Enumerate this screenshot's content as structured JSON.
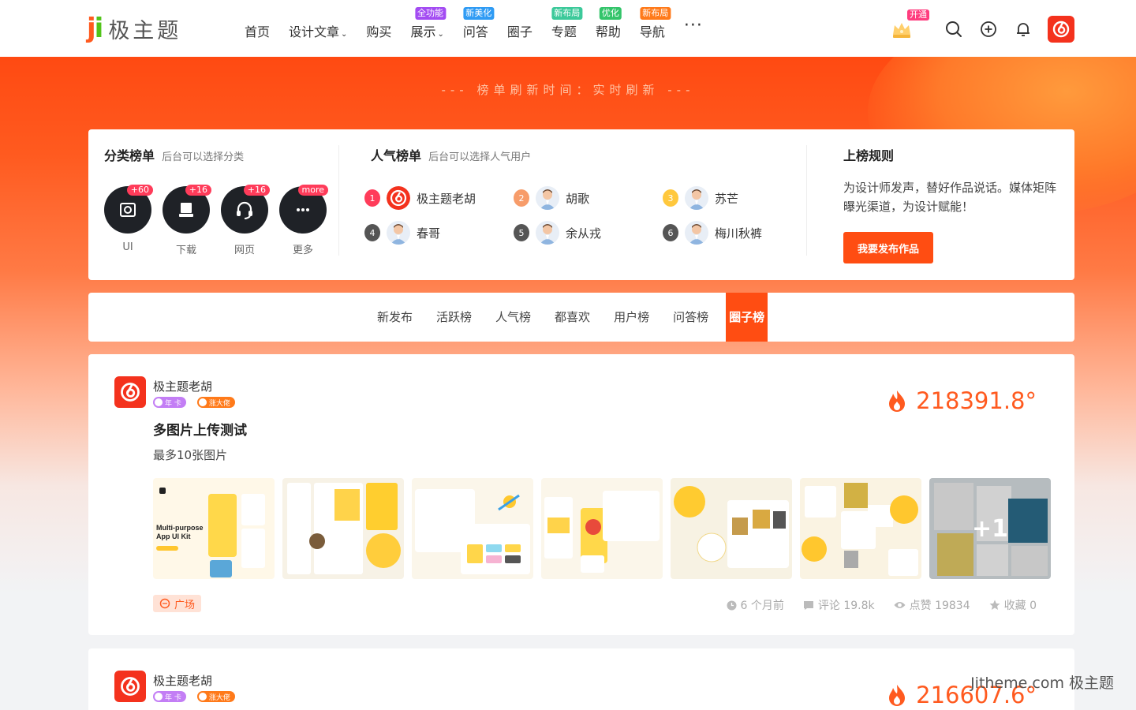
{
  "header": {
    "logo": {
      "mark": "ji",
      "text": "极主题"
    },
    "nav": [
      {
        "label": "首页",
        "badge": null,
        "dropdown": false
      },
      {
        "label": "设计文章",
        "badge": null,
        "dropdown": true
      },
      {
        "label": "购买",
        "badge": null,
        "dropdown": false
      },
      {
        "label": "展示",
        "badge": "全功能",
        "badge_color": "#a34cf2",
        "dropdown": true
      },
      {
        "label": "问答",
        "badge": "新美化",
        "badge_color": "#2f9bf4",
        "dropdown": false
      },
      {
        "label": "圈子",
        "badge": null,
        "dropdown": false
      },
      {
        "label": "专题",
        "badge": "新布局",
        "badge_color": "#3cc99a",
        "dropdown": false
      },
      {
        "label": "帮助",
        "badge": "优化",
        "badge_color": "#33c46a",
        "dropdown": false
      },
      {
        "label": "导航",
        "badge": "新布局",
        "badge_color": "#ff7a1a",
        "dropdown": false
      }
    ],
    "more": "···",
    "vip_badge": "开通"
  },
  "banner": {
    "refresh_text": "--- 榜单刷新时间：实时刷新 ---"
  },
  "categories": {
    "title": "分类榜单",
    "subtitle": "后台可以选择分类",
    "items": [
      {
        "label": "UI",
        "count": "+60",
        "icon": "photo-icon"
      },
      {
        "label": "下载",
        "count": "+16",
        "icon": "download-icon"
      },
      {
        "label": "网页",
        "count": "+16",
        "icon": "headset-icon"
      },
      {
        "label": "更多",
        "count": "more",
        "icon": "more-icon"
      }
    ]
  },
  "popular": {
    "title": "人气榜单",
    "subtitle": "后台可以选择人气用户",
    "users": [
      {
        "rank": "1",
        "name": "极主题老胡",
        "color": "#ff3c5a",
        "avatar": "brand"
      },
      {
        "rank": "2",
        "name": "胡歌",
        "color": "#f79c6a",
        "avatar": "person"
      },
      {
        "rank": "3",
        "name": "苏芒",
        "color": "#ffc83d",
        "avatar": "person"
      },
      {
        "rank": "4",
        "name": "春哥",
        "color": "#555",
        "avatar": "person"
      },
      {
        "rank": "5",
        "name": "余从戎",
        "color": "#555",
        "avatar": "person"
      },
      {
        "rank": "6",
        "name": "梅川秋裤",
        "color": "#555",
        "avatar": "person"
      }
    ]
  },
  "rules": {
    "title": "上榜规则",
    "text": "为设计师发声，替好作品说话。媒体矩阵曝光渠道，为设计赋能！",
    "button": "我要发布作品"
  },
  "tabs": [
    {
      "label": "新发布",
      "active": false
    },
    {
      "label": "活跃榜",
      "active": false
    },
    {
      "label": "人气榜",
      "active": false
    },
    {
      "label": "都喜欢",
      "active": false
    },
    {
      "label": "用户榜",
      "active": false
    },
    {
      "label": "问答榜",
      "active": false
    },
    {
      "label": "圈子榜",
      "active": true
    }
  ],
  "posts": [
    {
      "author": "极主题老胡",
      "vip": "年 卡",
      "level": "涨大佬",
      "heat": "218391.8°",
      "title": "多图片上传测试",
      "excerpt": "最多10张图片",
      "thumb_more": "+1",
      "tag": "广场",
      "meta": {
        "time": "6 个月前",
        "comments": "评论 19.8k",
        "likes": "点赞 19834",
        "favorites": "收藏 0"
      }
    },
    {
      "author": "极主题老胡",
      "vip": "年 卡",
      "level": "涨大佬",
      "heat": "216607.6°"
    }
  ],
  "watermark": "Jitheme.com 极主题"
}
